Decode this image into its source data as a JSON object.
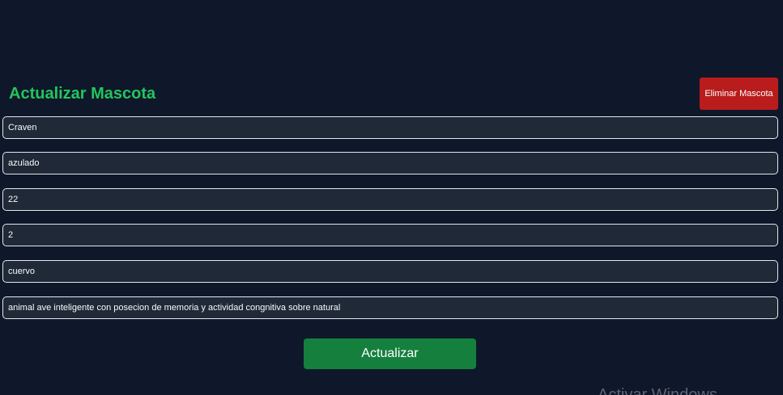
{
  "form": {
    "title": "Actualizar Mascota",
    "delete_label": "Eliminar Mascota",
    "fields": [
      {
        "value": "Craven"
      },
      {
        "value": "azulado"
      },
      {
        "value": "22"
      },
      {
        "value": "2"
      },
      {
        "value": "cuervo"
      },
      {
        "value": "animal ave inteligente con posecion de memoria y actividad congnitiva sobre natural"
      }
    ],
    "submit_label": "Actualizar"
  },
  "overlay": {
    "watermark_text": "Activar Windows"
  },
  "colors": {
    "background": "#0f172a",
    "title": "#22c55e",
    "delete_button": "#b91c1c",
    "submit_button": "#15803d",
    "field_background": "#1f2937",
    "field_border": "#e5e7eb"
  }
}
